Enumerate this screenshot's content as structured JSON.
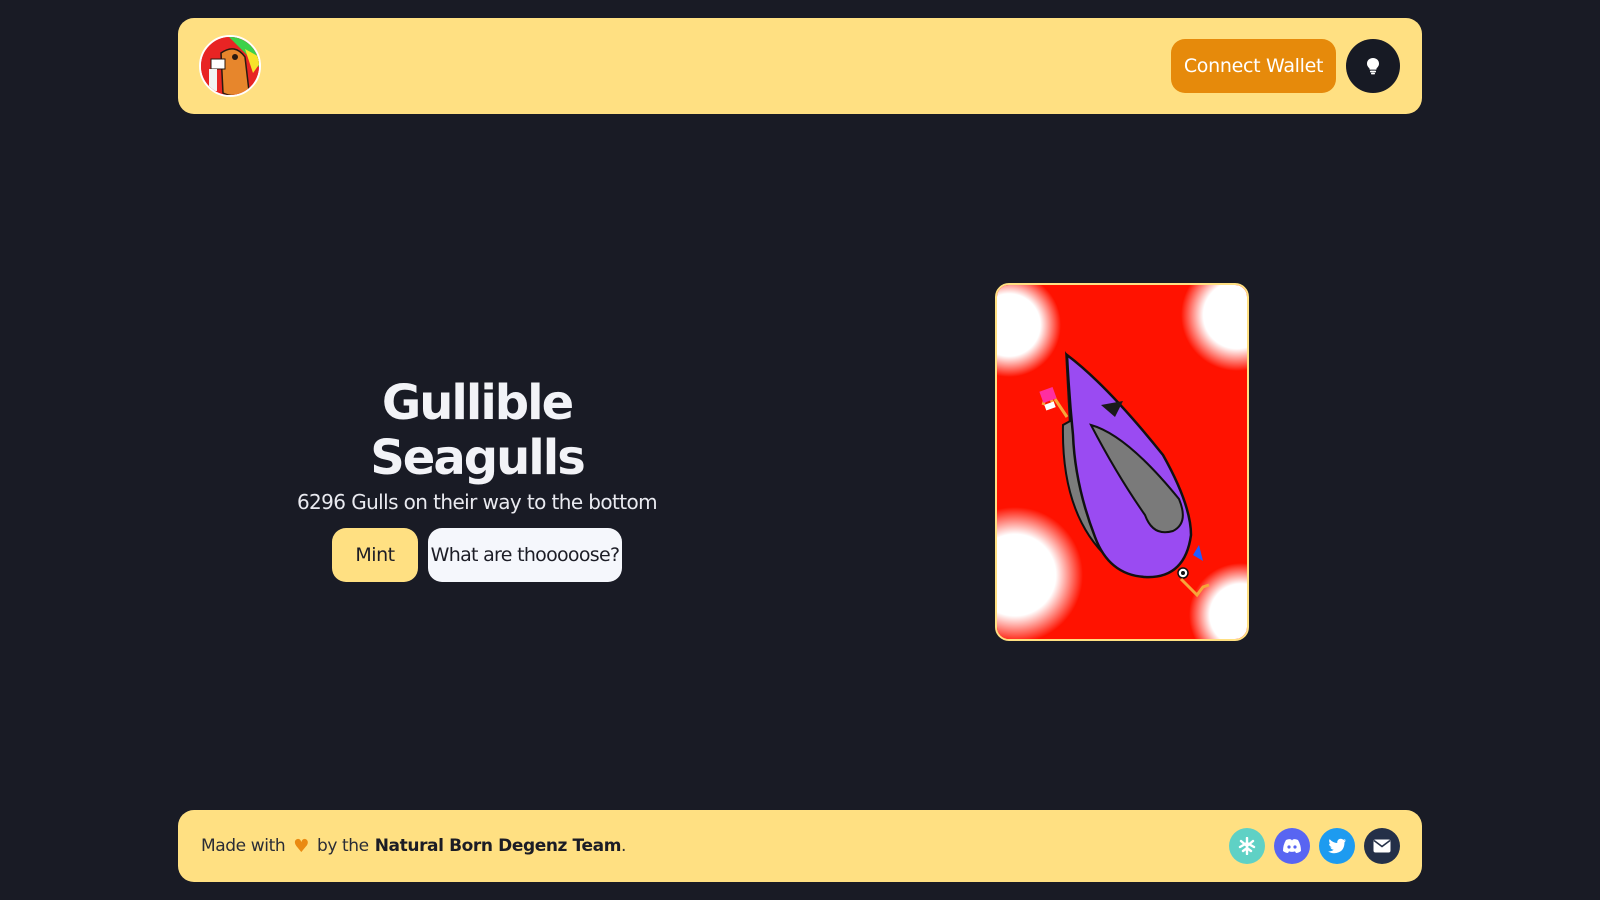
{
  "nav": {
    "logo_icon": "seagull-avatar-icon",
    "connect_label": "Connect Wallet",
    "theme_icon": "lightbulb-icon"
  },
  "hero": {
    "title": "Gullible Seagulls",
    "subtitle": "6296 Gulls on their way to the bottom",
    "mint_label": "Mint",
    "what_label": "What are thooooose?"
  },
  "nft": {
    "image_icon": "seagull-nft-image"
  },
  "footer": {
    "made_with": "Made with",
    "by_the": "by the",
    "team": "Natural Born Degenz Team",
    "period": ".",
    "socials": [
      {
        "icon": "linktree-icon",
        "color": "#5fd1c5"
      },
      {
        "icon": "discord-icon",
        "color": "#5865f2"
      },
      {
        "icon": "twitter-icon",
        "color": "#1d9bf0"
      },
      {
        "icon": "mail-icon",
        "color": "#243048"
      }
    ]
  },
  "colors": {
    "background": "#191b25",
    "accent": "#ffe082",
    "orange": "#e68a0b"
  }
}
